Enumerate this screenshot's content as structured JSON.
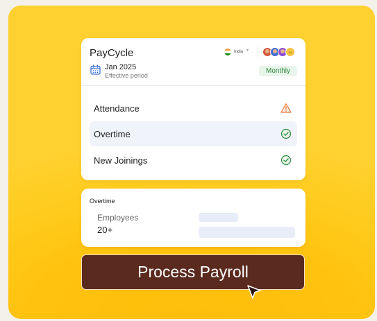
{
  "app": {
    "title": "PayCycle"
  },
  "country": {
    "name": "India",
    "flag_colors": [
      "#ff9933",
      "#ffffff",
      "#138808"
    ]
  },
  "period": {
    "date": "Jan 2025",
    "label": "Effective period",
    "frequency": "Monthly"
  },
  "avatars": {
    "overflow_count": "3+"
  },
  "checklist": [
    {
      "label": "Attendance",
      "status": "warning",
      "icon": "warning-icon"
    },
    {
      "label": "Overtime",
      "status": "done",
      "icon": "check-circle-icon"
    },
    {
      "label": "New Joinings",
      "status": "done",
      "icon": "check-circle-icon"
    }
  ],
  "detail": {
    "title": "Overtime",
    "metric_label": "Employees",
    "metric_value": "20+"
  },
  "cta": {
    "label": "Process Payroll"
  },
  "colors": {
    "background": "#ffc20f",
    "cta": "#5b2a1f",
    "success": "#2d8a3e",
    "warning": "#e8773a",
    "calendar": "#3b73d9"
  }
}
